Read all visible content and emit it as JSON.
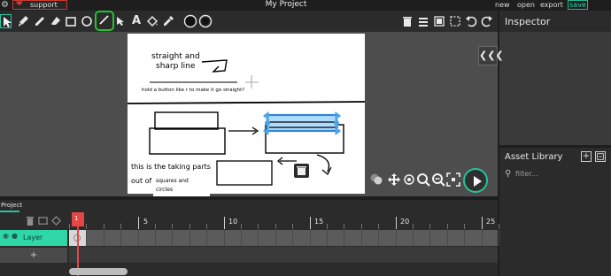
{
  "menu": {
    "support_label": "support us",
    "title": "My Project",
    "new": "new",
    "open": "open",
    "export": "export",
    "save": "save"
  },
  "toolbar": {
    "tools": [
      "cursor-select-icon",
      "brush-icon",
      "pencil-icon",
      "eraser-icon",
      "rectangle-icon",
      "ellipse-icon",
      "line-icon",
      "path-icon",
      "text-icon",
      "fill-bucket-icon",
      "eyedropper-icon",
      "fill-color-swatch",
      "stroke-color-swatch",
      "delete-icon",
      "layers-icon",
      "group-icon",
      "ungroup-icon",
      "undo-icon",
      "redo-icon"
    ],
    "text_tool_glyph": "A"
  },
  "colors": {
    "accent": "#2fd6a6",
    "highlight_green": "#22c531",
    "support_border": "#d0392f",
    "playhead": "#e74545",
    "selection_blue": "#4aa3e6"
  },
  "inspector": {
    "title": "Inspector"
  },
  "assets": {
    "title": "Asset Library",
    "search_placeholder": "filter..."
  },
  "canvas": {
    "text_line1": "straight and",
    "text_line2": "sharp line",
    "hint": "hold a button like r to make it go straight?",
    "caption_line1": "this is the taking parts",
    "caption_line2": "out of",
    "caption_small1": "squares and",
    "caption_small2": "circles"
  },
  "stage": {
    "collapse_glyph": "❮❮❮"
  },
  "timeline": {
    "tab": "Project",
    "layer_name": "Layer",
    "add_layer_glyph": "+",
    "frame_numbers": [
      "5",
      "10",
      "15",
      "20",
      "25"
    ],
    "current_frame": "1"
  }
}
